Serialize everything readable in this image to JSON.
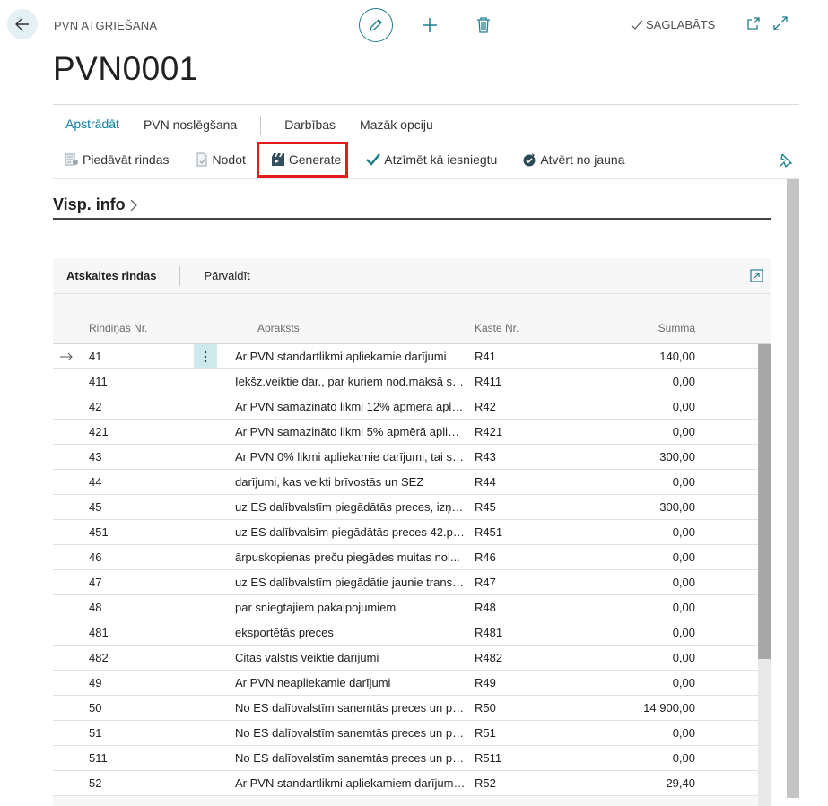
{
  "header": {
    "caption": "PVN ATGRIEŠANA",
    "saved_label": "SAGLABĀTS",
    "title": "PVN0001"
  },
  "tabs": [
    {
      "label": "Apstrādāt",
      "active": true
    },
    {
      "label": "PVN noslēgšana",
      "active": false
    },
    {
      "label": "Darbības",
      "active": false
    },
    {
      "label": "Mazāk opciju",
      "active": false
    }
  ],
  "actions": [
    {
      "label": "Piedāvāt rindas",
      "icon": "suggest-lines-icon"
    },
    {
      "label": "Nodot",
      "icon": "release-icon"
    },
    {
      "label": "Generate",
      "icon": "generate-icon"
    },
    {
      "label": "Atzīmēt kā iesniegtu",
      "icon": "checkmark-icon"
    },
    {
      "label": "Atvērt no jauna",
      "icon": "reopen-icon"
    }
  ],
  "section": {
    "label": "Visp. info"
  },
  "lines_panel": {
    "tab_active": "Atskaites rindas",
    "tab_other": "Pārvaldīt",
    "columns": {
      "nr": "Rindiņas Nr.",
      "desc": "Apraksts",
      "box": "Kaste Nr.",
      "sum": "Summa"
    },
    "rows": [
      {
        "nr": "41",
        "desc": "Ar PVN standartlikmi apliekamie darījumi",
        "box": "R41",
        "sum": "140,00"
      },
      {
        "nr": "411",
        "desc": "Iekšz.veiktie dar., par kuriem nod.maksā saņ...",
        "box": "R411",
        "sum": "0,00"
      },
      {
        "nr": "42",
        "desc": "Ar PVN samazināto likmi 12% apmērā apliek...",
        "box": "R42",
        "sum": "0,00"
      },
      {
        "nr": "421",
        "desc": "Ar PVN samazināto likmi 5% apmērā apliek...",
        "box": "R421",
        "sum": "0,00"
      },
      {
        "nr": "43",
        "desc": "Ar PVN 0% likmi apliekamie darījumi, tai sk...",
        "box": "R43",
        "sum": "300,00"
      },
      {
        "nr": "44",
        "desc": "darījumi, kas veikti brīvostās un SEZ",
        "box": "R44",
        "sum": "0,00"
      },
      {
        "nr": "45",
        "desc": "uz ES dalībvalstīm piegādātās preces, izņ.4...",
        "box": "R45",
        "sum": "300,00"
      },
      {
        "nr": "451",
        "desc": "uz ES dalībvalsīm piegādātās preces 42.p.1...",
        "box": "R451",
        "sum": "0,00"
      },
      {
        "nr": "46",
        "desc": "ārpuskopienas preču piegādes muitas nol...",
        "box": "R46",
        "sum": "0,00"
      },
      {
        "nr": "47",
        "desc": "uz ES dalībvalstīm piegādātie jaunie transp...",
        "box": "R47",
        "sum": "0,00"
      },
      {
        "nr": "48",
        "desc": "par sniegtajiem pakalpojumiem",
        "box": "R48",
        "sum": "0,00"
      },
      {
        "nr": "481",
        "desc": "eksportētās preces",
        "box": "R481",
        "sum": "0,00"
      },
      {
        "nr": "482",
        "desc": "Citās valstīs veiktie darījumi",
        "box": "R482",
        "sum": "0,00"
      },
      {
        "nr": "49",
        "desc": "Ar PVN neapliekamie darījumi",
        "box": "R49",
        "sum": "0,00"
      },
      {
        "nr": "50",
        "desc": "No ES dalībvalstīm saņemtās preces un pa...",
        "box": "R50",
        "sum": "14 900,00"
      },
      {
        "nr": "51",
        "desc": "No ES dalībvalstīm saņemtās preces un pa...",
        "box": "R51",
        "sum": "0,00"
      },
      {
        "nr": "511",
        "desc": "No ES dalībvalstīm saņemtās preces un pa...",
        "box": "R511",
        "sum": "0,00"
      },
      {
        "nr": "52",
        "desc": "Ar PVN standartlikmi apliekamiem darījumi...",
        "box": "R52",
        "sum": "29,40"
      }
    ]
  },
  "colors": {
    "accent": "#0f7ea0",
    "highlight": "#e41c1c",
    "selected_cell": "#cde9ec"
  }
}
